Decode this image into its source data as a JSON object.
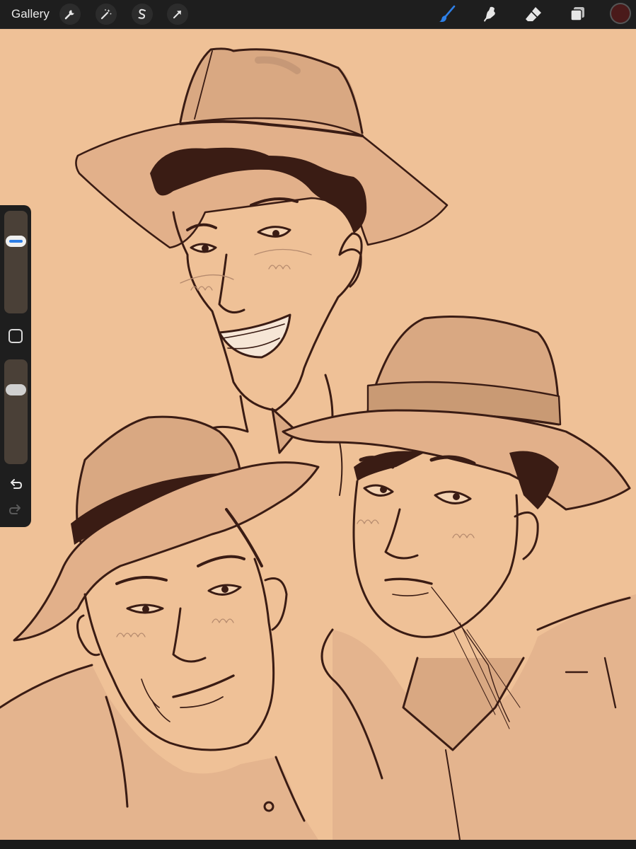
{
  "toolbar": {
    "gallery_label": "Gallery",
    "left_tools": [
      {
        "icon": "wrench-icon",
        "name": "actions"
      },
      {
        "icon": "magic-wand-icon",
        "name": "adjustments"
      },
      {
        "icon": "selection-s-icon",
        "name": "selection"
      },
      {
        "icon": "transform-arrow-icon",
        "name": "transform"
      }
    ],
    "right_tools": [
      {
        "icon": "brush-icon",
        "name": "paint",
        "active": true
      },
      {
        "icon": "smudge-icon",
        "name": "smudge",
        "active": false
      },
      {
        "icon": "eraser-icon",
        "name": "erase",
        "active": false
      },
      {
        "icon": "layers-icon",
        "name": "layers",
        "active": false
      }
    ],
    "current_color": "#4a1a1a"
  },
  "sidebar": {
    "brush_size_level": 0.74,
    "opacity_level": 0.74,
    "undo_icon": "undo-icon",
    "redo_icon": "redo-icon",
    "modify_icon": "square-modify-icon"
  },
  "colors": {
    "toolbar_bg": "#1e1e1e",
    "canvas_bg": "#efc197",
    "ink": "#3a1c14",
    "shade": "#c99a74",
    "active_tool": "#2e7fe6"
  }
}
